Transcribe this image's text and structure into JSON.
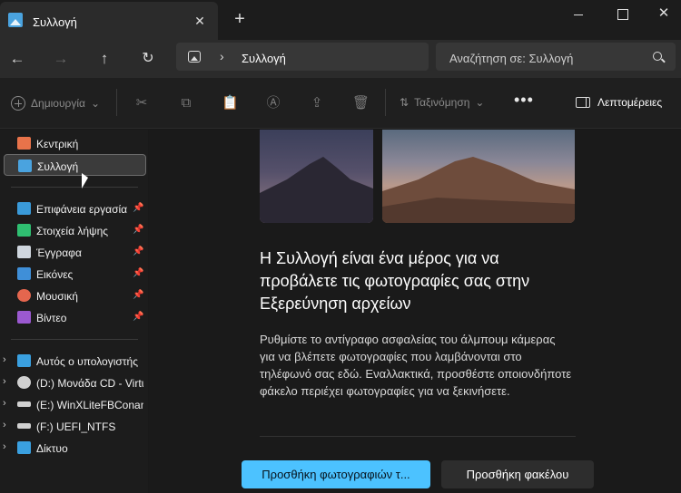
{
  "window": {
    "tab_title": "Συλλογή",
    "close_tab_glyph": "✕",
    "new_tab_glyph": "+",
    "close_glyph": "✕"
  },
  "nav": {
    "back_glyph": "←",
    "forward_glyph": "→",
    "up_glyph": "↑",
    "refresh_glyph": "↻",
    "breadcrumb_separator": "›",
    "breadcrumb": "Συλλογή",
    "search_placeholder": "Αναζήτηση σε: Συλλογή"
  },
  "toolbar": {
    "new_label": "Δημιουργία",
    "new_chevron": "⌄",
    "cut_icon": "✂",
    "copy_icon": "⧉",
    "paste_icon": "📋",
    "rename_icon": "Ⓐ",
    "share_icon": "⇪",
    "delete_icon": "🗑",
    "sort_icon": "⇅",
    "sort_label": "Ταξινόμηση",
    "sort_chevron": "⌄",
    "more_label": "•••",
    "details_label": "Λεπτομέρειες"
  },
  "sidebar": {
    "pin_glyph": "📌",
    "expander_glyph": "›",
    "items": [
      {
        "label": "Κεντρική",
        "icon": "home-icon",
        "color": "#e8734a"
      },
      {
        "label": "Συλλογή",
        "icon": "gallery-icon",
        "color": "#4aa3df"
      },
      {
        "label": "Επιφάνεια εργασίας",
        "icon": "desktop-icon",
        "color": "#3a9ad9"
      },
      {
        "label": "Στοιχεία λήψης",
        "icon": "download-icon",
        "color": "#2fbf71"
      },
      {
        "label": "Έγγραφα",
        "icon": "documents-icon",
        "color": "#cfd6de"
      },
      {
        "label": "Εικόνες",
        "icon": "pictures-icon",
        "color": "#3f8fd8"
      },
      {
        "label": "Μουσική",
        "icon": "music-icon",
        "color": "#e4664e"
      },
      {
        "label": "Βίντεο",
        "icon": "video-icon",
        "color": "#9b59d0"
      },
      {
        "label": "Αυτός ο υπολογιστής",
        "icon": "computer-icon",
        "color": "#3aa0e0"
      },
      {
        "label": "(D:) Μονάδα CD - Virtu",
        "icon": "cd-drive-icon",
        "color": "#d0d0d0"
      },
      {
        "label": "(E:) WinXLiteFBConan",
        "icon": "drive-icon",
        "color": "#d0d0d0"
      },
      {
        "label": "(F:) UEFI_NTFS",
        "icon": "drive-icon",
        "color": "#d0d0d0"
      },
      {
        "label": "Δίκτυο",
        "icon": "network-icon",
        "color": "#3aa0e0"
      }
    ]
  },
  "main": {
    "headline": "Η Συλλογή είναι ένα μέρος για να προβάλετε τις φωτογραφίες σας στην Εξερεύνηση αρχείων",
    "body": "Ρυθμίστε το αντίγραφο ασφαλείας του άλμπουμ κάμερας για να βλέπετε φωτογραφίες που λαμβάνονται στο τηλέφωνό σας εδώ. Εναλλακτικά, προσθέστε οποιονδήποτε φάκελο περιέχει φωτογραφίες για να ξεκινήσετε.",
    "primary_button": "Προσθήκη φωτογραφιών τ...",
    "secondary_button": "Προσθήκη φακέλου",
    "accent_color": "#4cc2ff"
  }
}
